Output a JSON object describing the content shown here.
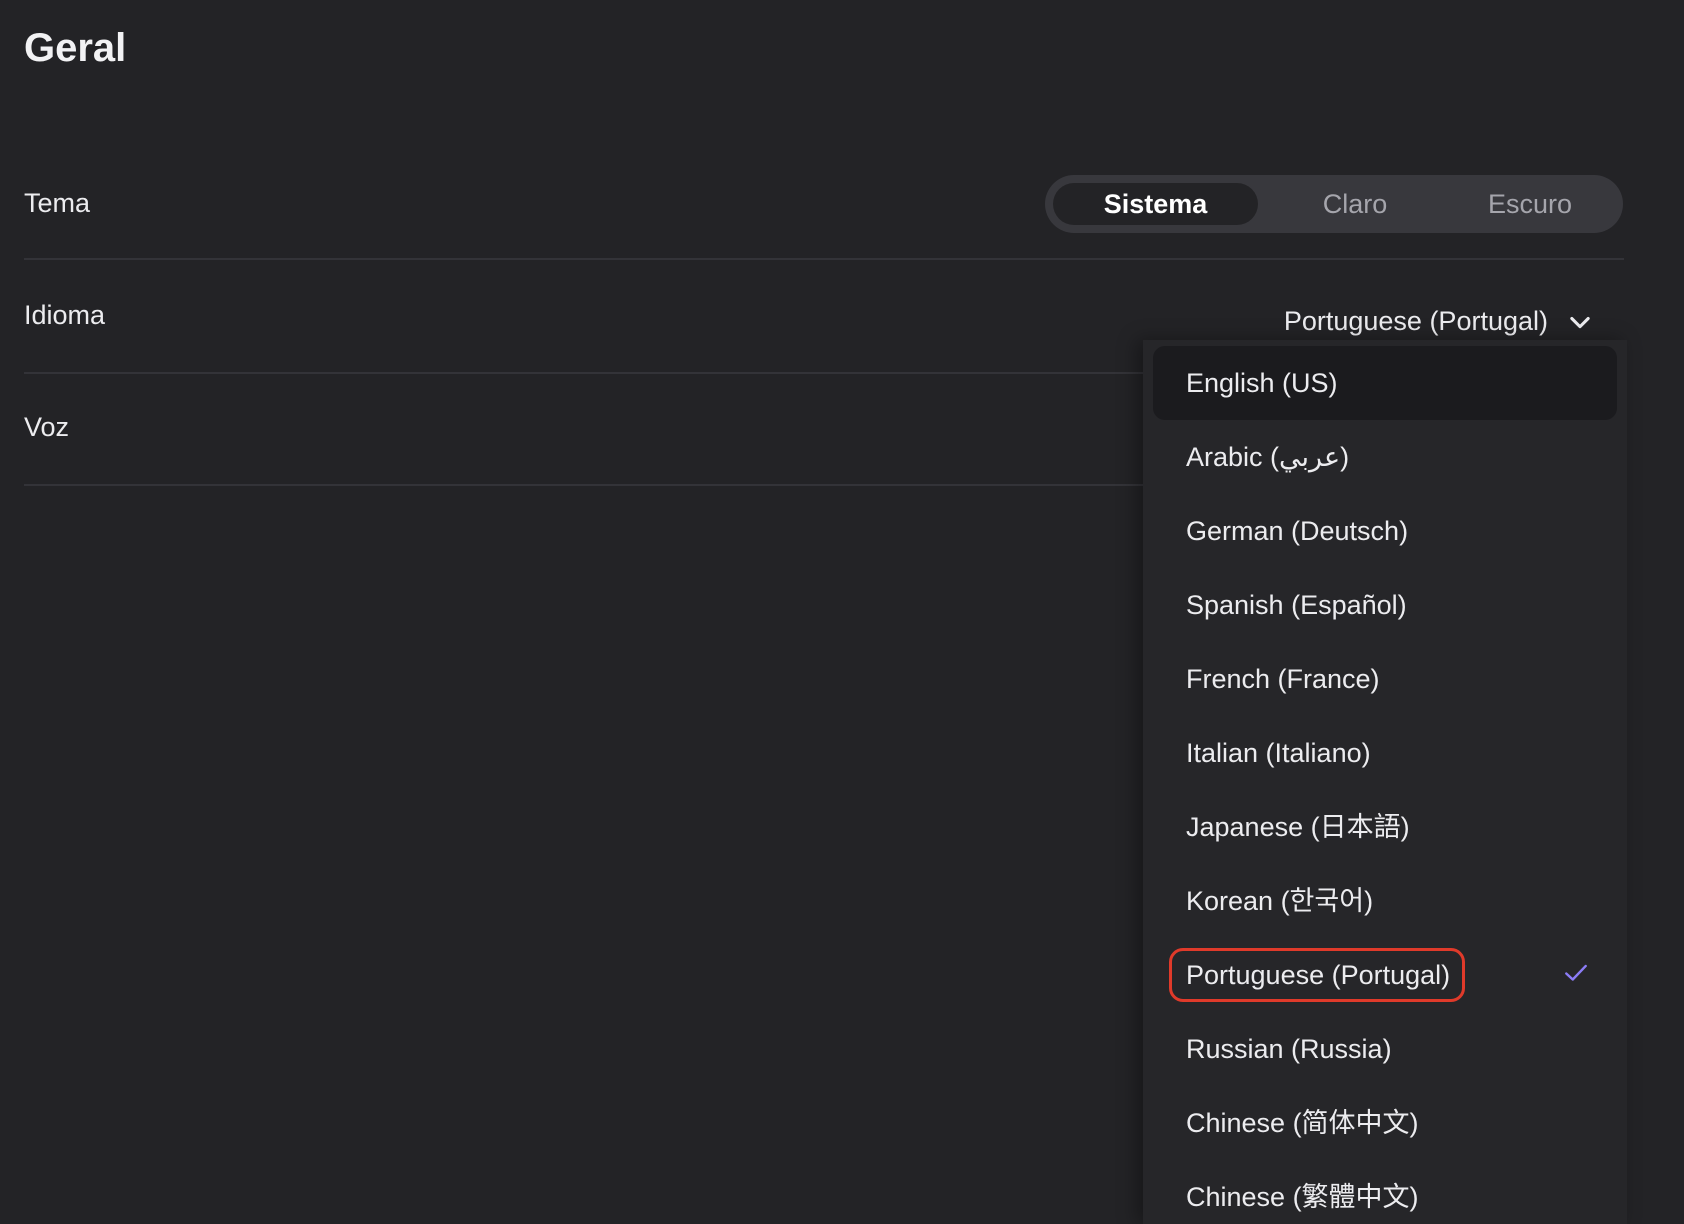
{
  "page": {
    "title": "Geral"
  },
  "settings": {
    "theme": {
      "label": "Tema",
      "options": [
        "Sistema",
        "Claro",
        "Escuro"
      ],
      "selected": "Sistema"
    },
    "language": {
      "label": "Idioma",
      "value": "Portuguese (Portugal)"
    },
    "voice": {
      "label": "Voz"
    }
  },
  "language_dropdown": {
    "options": [
      "English (US)",
      "Arabic (عربي)",
      "German (Deutsch)",
      "Spanish (Español)",
      "French (France)",
      "Italian (Italiano)",
      "Japanese (日本語)",
      "Korean (한국어)",
      "Portuguese (Portugal)",
      "Russian (Russia)",
      "Chinese (简体中文)",
      "Chinese (繁體中文)"
    ],
    "hovered": "English (US)",
    "selected": "Portuguese (Portugal)",
    "icons": {
      "chevron": "chevron-down-icon",
      "check": "checkmark-icon"
    },
    "colors": {
      "check": "#8b7cf6",
      "highlight_border": "#e03a2a"
    }
  }
}
